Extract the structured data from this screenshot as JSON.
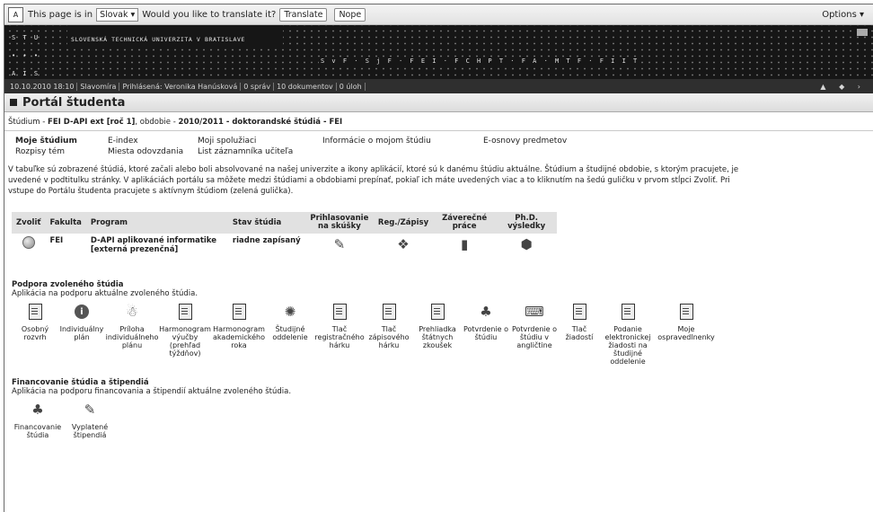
{
  "translate_bar": {
    "prefix": "This page is in",
    "language": "Slovak ▾",
    "question": "Would you like to translate it?",
    "translate": "Translate",
    "nope": "Nope",
    "options": "Options ▾"
  },
  "header": {
    "letters": [
      "S T U",
      "• • •",
      "A I S"
    ],
    "university": "SLOVENSKÁ TECHNICKÁ UNIVERZITA V BRATISLAVE",
    "faculties": "S v F · S j F · F E I · F C H P T · F A · M T F · F I I T"
  },
  "statusbar": {
    "datetime": "10.10.2010 18:10",
    "user": "Slavomíra",
    "logged": "Prihlásená: Veronika Hanúsková",
    "messages": "0 správ",
    "documents": "10 dokumentov",
    "tasks": "0 úloh",
    "right": "▲ ◆ ›"
  },
  "portal_title": "Portál študenta",
  "breadcrumb": {
    "prefix": "Štúdium - ",
    "study": "FEI D-API ext [roč 1]",
    "mid": ", obdobie - ",
    "period": "2010/2011 - doktorandské štúdiá - FEI"
  },
  "menu": {
    "moje_studium": "Moje štúdium",
    "e_index": "E-index",
    "moji_spoluziaci": "Moji spolužiaci",
    "informacie": "Informácie o mojom štúdiu",
    "e_osnovy": "E-osnovy predmetov",
    "rozpisy": "Rozpisy tém",
    "miesta": "Miesta odovzdania",
    "list": "List záznamníka učiteľa"
  },
  "info_lines": [
    "V tabuľke sú zobrazené štúdiá, ktoré začali alebo boli absolvované na našej univerzite a ikony aplikácií, ktoré sú k danému štúdiu aktuálne. Štúdium a študijné obdobie, s ktorým pracujete, je",
    "uvedené v podtitulku stránky. V aplikáciách portálu sa môžete medzi štúdiami a obdobiami prepínať, pokiaľ ich máte uvedených viac a to kliknutím na šedú guličku v prvom stĺpci Zvoliť. Pri",
    "vstupe do Portálu študenta pracujete s aktívnym štúdiom (zelená gulička)."
  ],
  "study_table": {
    "headers": [
      "Zvoliť",
      "Fakulta",
      "Program",
      "Stav štúdia",
      "Prihlasovanie na skúšky",
      "Reg./Zápisy",
      "Záverečné práce",
      "Ph.D. výsledky"
    ],
    "row": {
      "faculty": "FEI",
      "program_line1": "D-API aplikované informatike",
      "program_line2": "[externá prezenčná]",
      "status": "riadne zapísaný"
    }
  },
  "support": {
    "title": "Podpora zvoleného štúdia",
    "subtitle": "Aplikácia na podporu aktuálne zvoleného štúdia.",
    "apps": [
      {
        "label": "Osobný rozvrh",
        "icon": "document-icon"
      },
      {
        "label": "Individuálny plán",
        "icon": "info-icon"
      },
      {
        "label": "Príloha individuálneho plánu",
        "icon": "people-icon"
      },
      {
        "label": "Harmonogram výučby (prehľad týždňov)",
        "icon": "calendar-icon"
      },
      {
        "label": "Harmonogram akademického roka",
        "icon": "schedule-icon"
      },
      {
        "label": "Študijné oddelenie",
        "icon": "compass-icon"
      },
      {
        "label": "Tlač registračného hárku",
        "icon": "print-icon"
      },
      {
        "label": "Tlač zápisového hárku",
        "icon": "print-icon"
      },
      {
        "label": "Prehliadka štátnych zkoušek",
        "icon": "review-icon"
      },
      {
        "label": "Potvrdenie o štúdiu",
        "icon": "stamp-icon"
      },
      {
        "label": "Potvrdenie o štúdiu v angličtine",
        "icon": "stamp-en-icon"
      },
      {
        "label": "Tlač žiadostí",
        "icon": "print-request-icon"
      },
      {
        "label": "Podanie elektronickej žiadosti na študijné oddelenie",
        "icon": "submit-request-icon"
      },
      {
        "label": "Moje ospravedlnenky",
        "icon": "excuse-icon"
      }
    ]
  },
  "finance": {
    "title": "Financovanie štúdia a štipendiá",
    "subtitle": "Aplikácia na podporu financovania a štipendií aktuálne zvoleného štúdia.",
    "apps": [
      {
        "label": "Financovanie štúdia",
        "icon": "finance-icon"
      },
      {
        "label": "Vyplatené štipendiá",
        "icon": "scholarship-icon"
      }
    ]
  }
}
